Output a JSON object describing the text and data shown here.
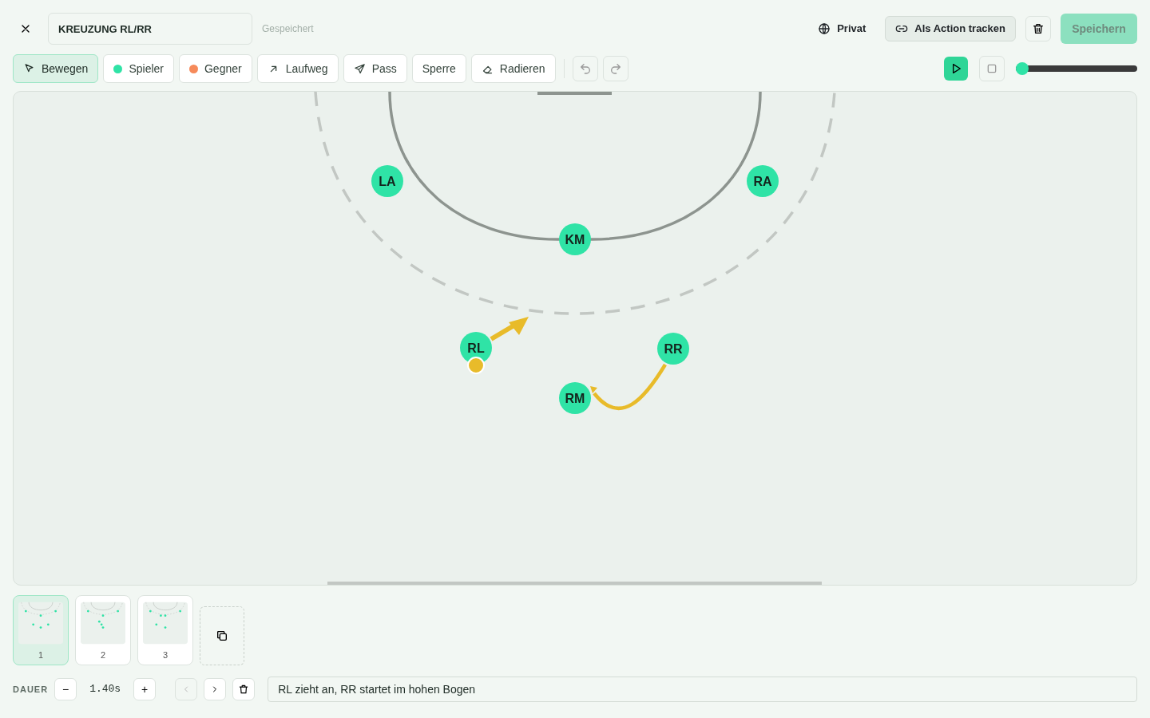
{
  "header": {
    "title_value": "KREUZUNG RL/RR",
    "save_status": "Gespeichert",
    "visibility": "Privat",
    "track_button": "Als Action tracken",
    "save_button": {
      "label": "Speichern",
      "disabled": true
    }
  },
  "tools": [
    {
      "label": "Bewegen",
      "kind": "move",
      "selected": true
    },
    {
      "label": "Spieler",
      "kind": "dot",
      "color": "#2fe3a6",
      "selected": false
    },
    {
      "label": "Gegner",
      "kind": "dot",
      "color": "#f68a5a",
      "selected": false
    },
    {
      "label": "Laufweg",
      "kind": "run",
      "selected": false
    },
    {
      "label": "Pass",
      "kind": "pass",
      "selected": false
    },
    {
      "label": "Sperre",
      "kind": "plain",
      "selected": false
    },
    {
      "label": "Radieren",
      "kind": "erase",
      "selected": false
    }
  ],
  "playback": {
    "playing": false,
    "level": 0
  },
  "court": {
    "players": [
      {
        "label": "LA"
      },
      {
        "label": "RA"
      },
      {
        "label": "KM"
      },
      {
        "label": "RL",
        "has_ball": true
      },
      {
        "label": "RR"
      },
      {
        "label": "RM"
      }
    ]
  },
  "frames": [
    {
      "label": "1",
      "selected": true
    },
    {
      "label": "2",
      "selected": false
    },
    {
      "label": "3",
      "selected": false
    }
  ],
  "footer": {
    "duration_label": "DAUER",
    "minus": "−",
    "duration": "1.40s",
    "plus": "+",
    "prev_disabled": true,
    "note_value": "RL zieht an, RR startet im hohen Bogen"
  }
}
